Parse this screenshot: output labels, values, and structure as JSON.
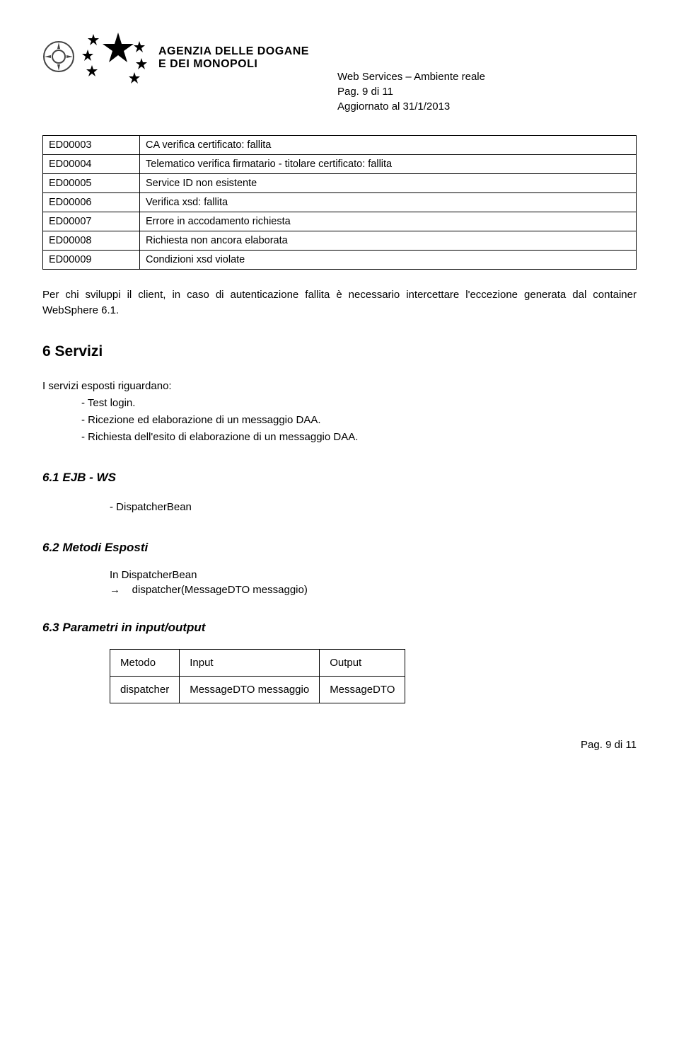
{
  "header": {
    "agency_line1": "AGENZIA DELLE DOGANE",
    "agency_line2": "E DEI MONOPOLI",
    "right_line1": "Web Services – Ambiente reale",
    "right_line2": "Pag. 9 di 11",
    "right_line3": "Aggiornato al 31/1/2013"
  },
  "codes": [
    {
      "code": "ED00003",
      "desc": "CA verifica certificato: fallita"
    },
    {
      "code": "ED00004",
      "desc": "Telematico verifica firmatario - titolare certificato: fallita"
    },
    {
      "code": "ED00005",
      "desc": "Service ID non esistente"
    },
    {
      "code": "ED00006",
      "desc": "Verifica xsd: fallita"
    },
    {
      "code": "ED00007",
      "desc": "Errore in accodamento richiesta"
    },
    {
      "code": "ED00008",
      "desc": "Richiesta non ancora elaborata"
    },
    {
      "code": "ED00009",
      "desc": "Condizioni xsd violate"
    }
  ],
  "para1": "Per chi sviluppi il client, in caso di autenticazione fallita è necessario intercettare l'eccezione generata dal container WebSphere 6.1.",
  "h6": "6  Servizi",
  "intro6": "I servizi esposti riguardano:",
  "items6": [
    "- Test login.",
    "- Ricezione ed elaborazione di un messaggio DAA.",
    "- Richiesta dell'esito di elaborazione di un messaggio DAA."
  ],
  "h61": "6.1    EJB - WS",
  "item61": "- DispatcherBean",
  "h62": "6.2    Metodi Esposti",
  "item62_line1": "In DispatcherBean",
  "item62_line2": "dispatcher(MessageDTO messaggio)",
  "h63": "6.3  Parametri in input/output",
  "params_table": {
    "headers": [
      "Metodo",
      "Input",
      "Output"
    ],
    "row": [
      "dispatcher",
      "MessageDTO messaggio",
      "MessageDTO"
    ]
  },
  "footer": "Pag. 9 di 11"
}
